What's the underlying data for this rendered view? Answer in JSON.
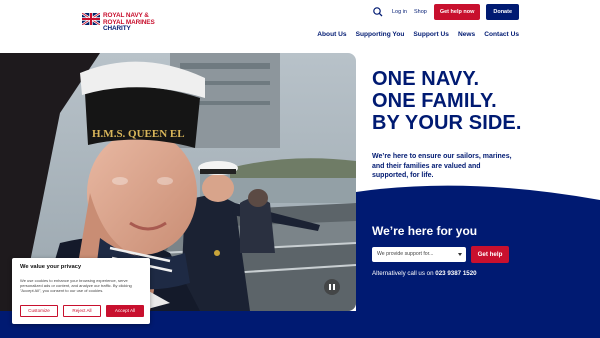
{
  "header": {
    "logo": {
      "line1": "ROYAL NAVY &",
      "line2": "ROYAL MARINES",
      "line3": "CHARITY"
    },
    "utility": {
      "login": "Log in",
      "shop": "Shop",
      "get_help": "Get help now",
      "donate": "Donate"
    },
    "nav": [
      "About Us",
      "Supporting You",
      "Support Us",
      "News",
      "Contact Us"
    ]
  },
  "hero": {
    "cap_text": "H.M.S. QUEEN EL",
    "headline": [
      "ONE NAVY.",
      "ONE FAMILY.",
      "BY YOUR SIDE."
    ],
    "intro": "We’re here to ensure our sailors, marines, and their families are valued and supported, for life."
  },
  "help_panel": {
    "title": "We’re here for you",
    "select_placeholder": "We provide support for...",
    "button": "Get help",
    "phone_prefix": "Alternatively call us on",
    "phone_number": "023 9387 1520"
  },
  "cookie": {
    "title": "We value your privacy",
    "text": "We use cookies to enhance your browsing experience, serve personalized ads or content, and analyze our traffic. By clicking \"Accept All\", you consent to our use of cookies.",
    "customize": "Customize",
    "reject": "Reject All",
    "accept": "Accept All"
  },
  "colors": {
    "navy": "#001a72",
    "red": "#c8102e"
  }
}
